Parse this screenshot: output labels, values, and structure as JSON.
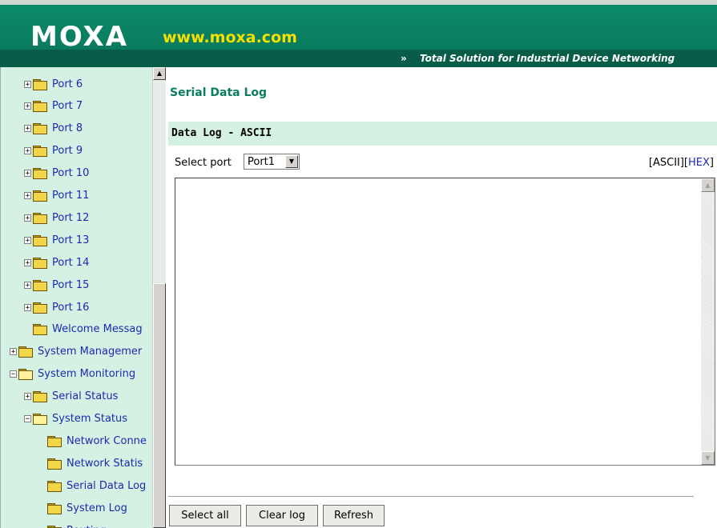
{
  "header": {
    "logo": "MOXA",
    "url": "www.moxa.com",
    "tagline_prefix": "»",
    "tagline": "Total Solution for Industrial Device Networking"
  },
  "tree": {
    "items": [
      {
        "label": "Port 6",
        "expander": "+",
        "open": false
      },
      {
        "label": "Port 7",
        "expander": "+",
        "open": false
      },
      {
        "label": "Port 8",
        "expander": "+",
        "open": false
      },
      {
        "label": "Port 9",
        "expander": "+",
        "open": false
      },
      {
        "label": "Port 10",
        "expander": "+",
        "open": false
      },
      {
        "label": "Port 11",
        "expander": "+",
        "open": false
      },
      {
        "label": "Port 12",
        "expander": "+",
        "open": false
      },
      {
        "label": "Port 13",
        "expander": "+",
        "open": false
      },
      {
        "label": "Port 14",
        "expander": "+",
        "open": false
      },
      {
        "label": "Port 15",
        "expander": "+",
        "open": false
      },
      {
        "label": "Port 16",
        "expander": "+",
        "open": false
      },
      {
        "label": "Welcome Messag",
        "expander": "",
        "open": false
      },
      {
        "label": "System Managemer",
        "expander": "+",
        "open": false
      },
      {
        "label": "System Monitoring",
        "expander": "−",
        "open": true
      },
      {
        "label": "Serial Status",
        "expander": "+",
        "open": false
      },
      {
        "label": "System Status",
        "expander": "−",
        "open": true
      },
      {
        "label": "Network Conne",
        "expander": "",
        "open": false
      },
      {
        "label": "Network Statis",
        "expander": "",
        "open": false
      },
      {
        "label": "Serial Data Log",
        "expander": "",
        "open": false
      },
      {
        "label": "System Log",
        "expander": "",
        "open": false
      },
      {
        "label": "Routing",
        "expander": "",
        "open": false
      }
    ]
  },
  "main": {
    "page_title": "Serial Data Log",
    "section_title": "Data Log - ASCII",
    "select_port_label": "Select port",
    "selected_port": "Port1",
    "format_open": "[",
    "format_ascii": "ASCII",
    "format_sep": "][",
    "format_hex": "HEX",
    "format_close": "]",
    "log_content": ""
  },
  "buttons": {
    "select_all": "Select all",
    "clear_log": "Clear log",
    "refresh": "Refresh"
  }
}
